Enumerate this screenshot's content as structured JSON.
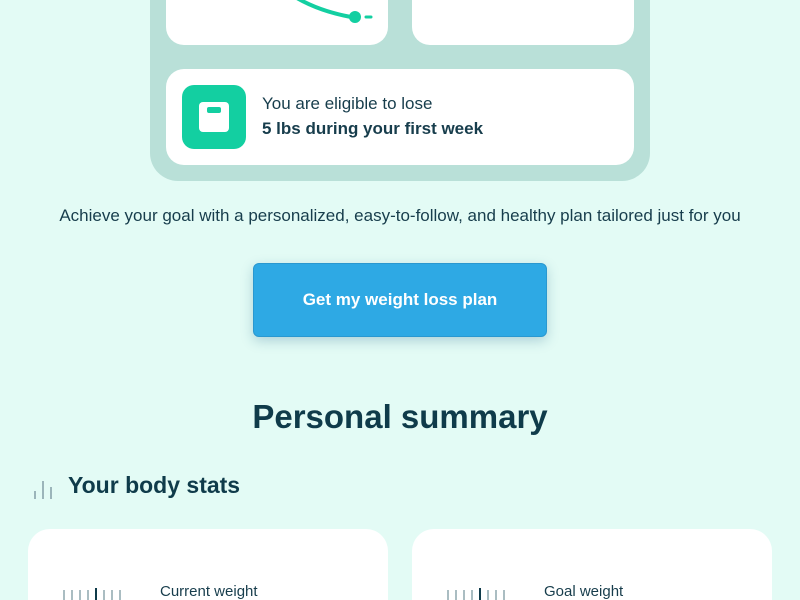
{
  "eligibility": {
    "line1": "You are eligible to lose",
    "line2": "5 lbs during your first week"
  },
  "tagline": "Achieve your goal with a personalized, easy-to-follow, and healthy plan tailored just for you",
  "cta": {
    "label": "Get my weight loss plan"
  },
  "summary": {
    "title": "Personal summary",
    "stats_title": "Your body stats",
    "cards": [
      {
        "label": "Current weight"
      },
      {
        "label": "Goal weight"
      }
    ]
  },
  "colors": {
    "background": "#e3fbf5",
    "panel": "#b9e0d8",
    "accent_green": "#13cfa1",
    "cta_blue": "#2ea9e4",
    "text_dark": "#0f3b4a"
  }
}
